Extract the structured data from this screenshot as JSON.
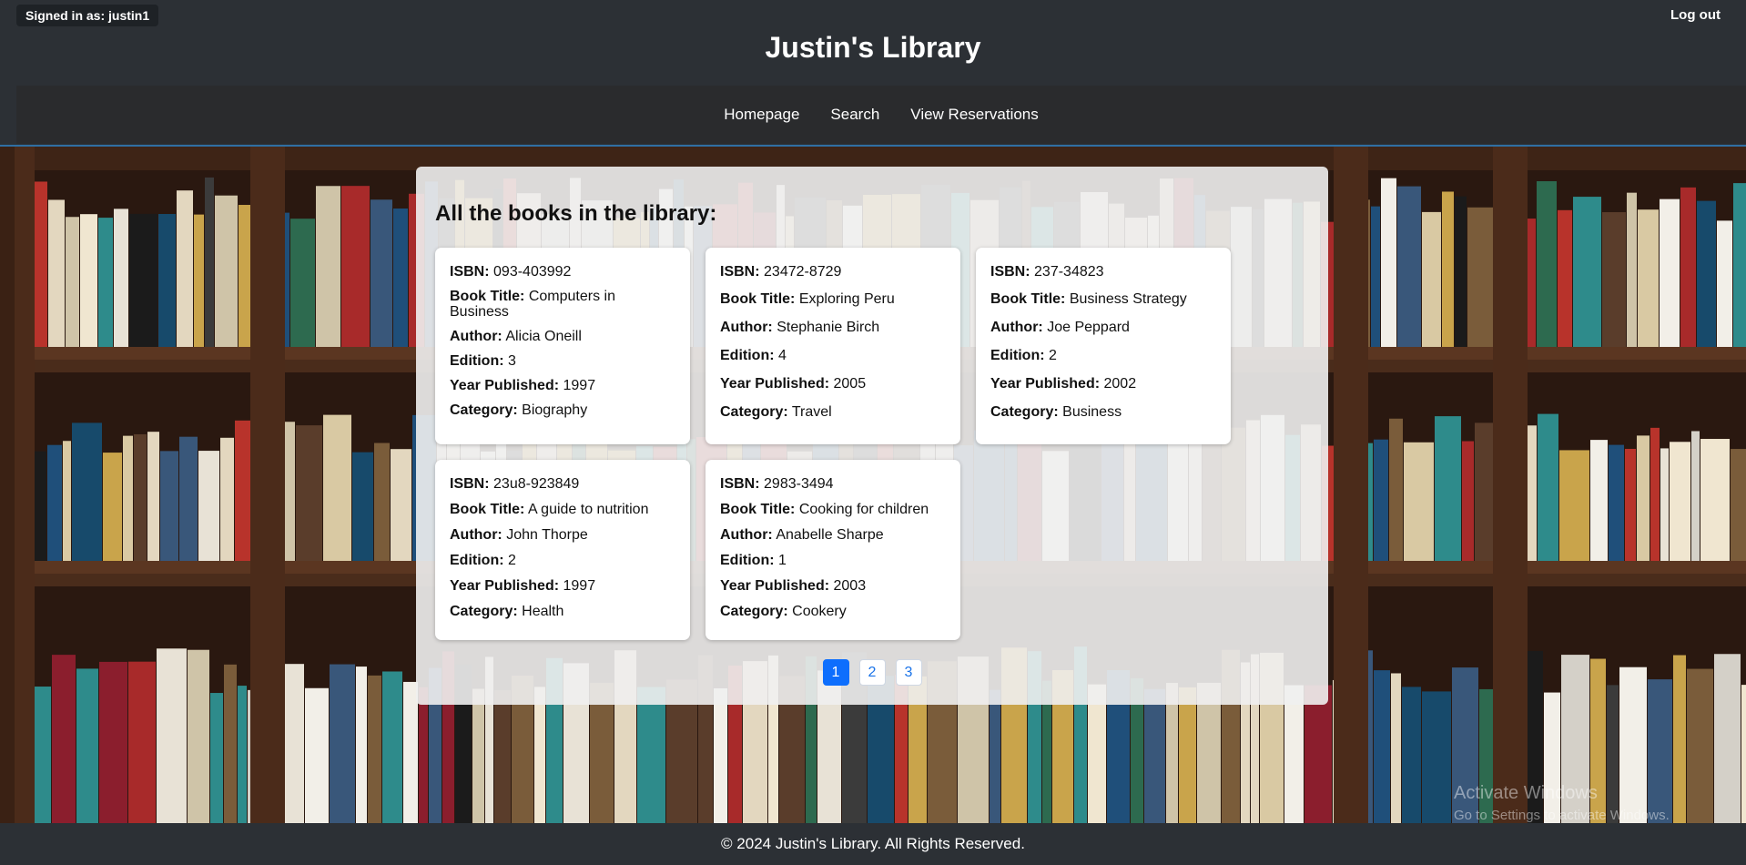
{
  "header": {
    "signed_in": "Signed in as: justin1",
    "logout": "Log out",
    "title": "Justin's Library"
  },
  "nav": {
    "items": [
      {
        "label": "Homepage"
      },
      {
        "label": "Search"
      },
      {
        "label": "View Reservations"
      }
    ]
  },
  "main": {
    "heading": "All the books in the library:",
    "field_labels": {
      "isbn": "ISBN:",
      "title": "Book Title:",
      "author": "Author:",
      "edition": "Edition:",
      "year": "Year Published:",
      "category": "Category:"
    },
    "books": [
      {
        "isbn": "093-403992",
        "title": "Computers in Business",
        "author": "Alicia Oneill",
        "edition": "3",
        "year": "1997",
        "category": "Biography"
      },
      {
        "isbn": "23472-8729",
        "title": "Exploring Peru",
        "author": "Stephanie Birch",
        "edition": "4",
        "year": "2005",
        "category": "Travel"
      },
      {
        "isbn": "237-34823",
        "title": "Business Strategy",
        "author": "Joe Peppard",
        "edition": "2",
        "year": "2002",
        "category": "Business"
      },
      {
        "isbn": "23u8-923849",
        "title": "A guide to nutrition",
        "author": "John Thorpe",
        "edition": "2",
        "year": "1997",
        "category": "Health"
      },
      {
        "isbn": "2983-3494",
        "title": "Cooking for children",
        "author": "Anabelle Sharpe",
        "edition": "1",
        "year": "2003",
        "category": "Cookery"
      }
    ],
    "pagination": {
      "pages": [
        "1",
        "2",
        "3"
      ],
      "current": "1"
    }
  },
  "watermark": {
    "line1": "Activate Windows",
    "line2": "Go to Settings to activate Windows."
  },
  "footer": {
    "text": "© 2024 Justin's Library. All Rights Reserved."
  },
  "colors": {
    "header_bg": "#2c3035",
    "nav_bg": "#2a2b2d",
    "accent": "#0d6efd",
    "shelf_wood": "#3a2418"
  }
}
